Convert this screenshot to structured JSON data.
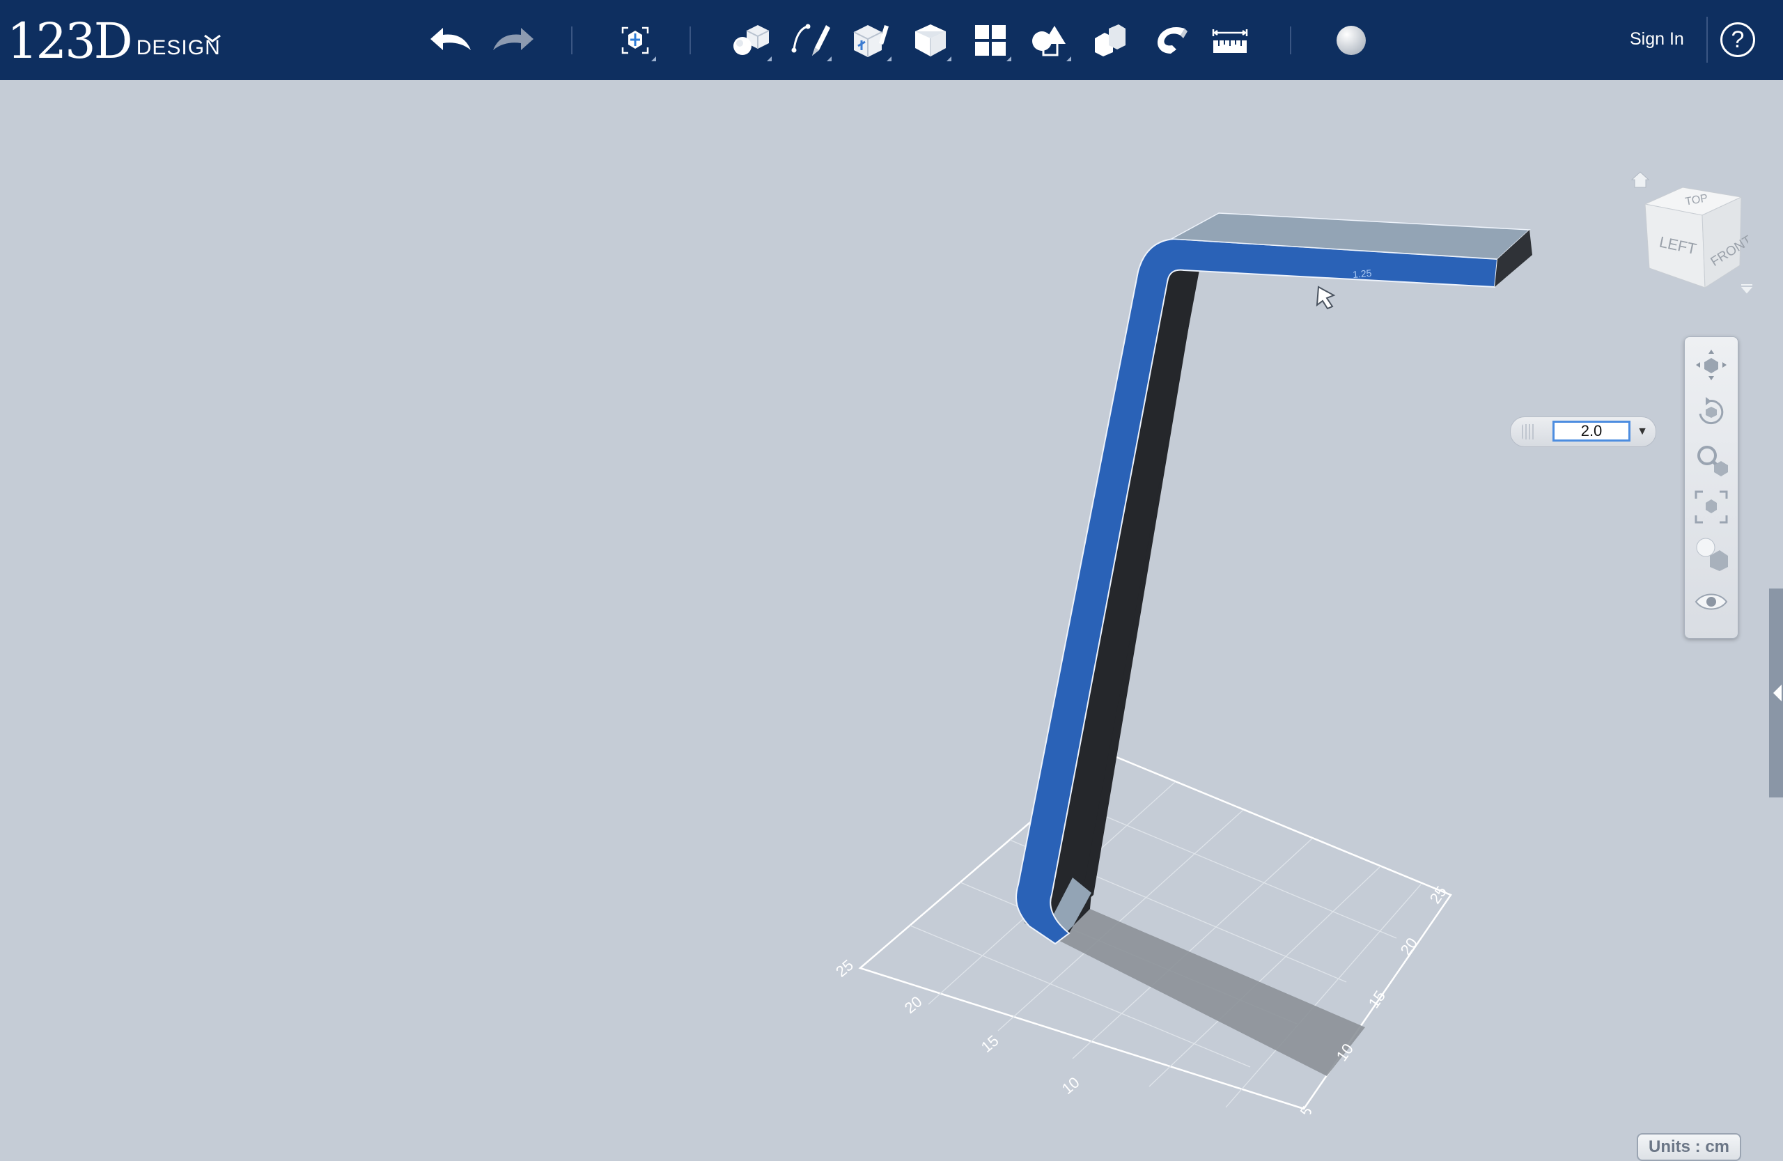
{
  "app": {
    "logo_number": "123D",
    "logo_word": "DESIGN"
  },
  "toolbar": {
    "items": [
      {
        "name": "undo",
        "icon": "undo-arrow-icon"
      },
      {
        "name": "redo",
        "icon": "redo-arrow-icon"
      },
      {
        "name": "transform",
        "icon": "transform-icon"
      },
      {
        "name": "primitives",
        "icon": "primitives-icon"
      },
      {
        "name": "sketch",
        "icon": "sketch-icon"
      },
      {
        "name": "construct",
        "icon": "construct-icon"
      },
      {
        "name": "modify",
        "icon": "modify-icon"
      },
      {
        "name": "pattern",
        "icon": "pattern-icon"
      },
      {
        "name": "grouping",
        "icon": "grouping-icon"
      },
      {
        "name": "combine",
        "icon": "combine-icon"
      },
      {
        "name": "snap",
        "icon": "snap-magnet-icon"
      },
      {
        "name": "measure",
        "icon": "measure-ruler-icon"
      },
      {
        "name": "material",
        "icon": "material-sphere-icon"
      }
    ],
    "sign_in": "Sign In",
    "help": "?"
  },
  "viewcube": {
    "faces": {
      "top": "TOP",
      "left": "LEFT",
      "front": "FRONT"
    }
  },
  "navbar": {
    "items": [
      "pan-icon",
      "orbit-icon",
      "zoom-icon",
      "fit-icon",
      "material-view-icon",
      "visibility-eye-icon"
    ]
  },
  "value_input": {
    "value": "2.0"
  },
  "grid": {
    "left_axis_labels": [
      "25",
      "20",
      "15",
      "10"
    ],
    "right_axis_labels": [
      "25",
      "20",
      "15",
      "10",
      "5"
    ]
  },
  "model": {
    "selected_face_color": "#2a62b7",
    "top_face_color": "#93a4b5",
    "dark_face_color": "#25272b",
    "dimension_tag": "1.25"
  },
  "status": {
    "units": "Units : cm"
  }
}
